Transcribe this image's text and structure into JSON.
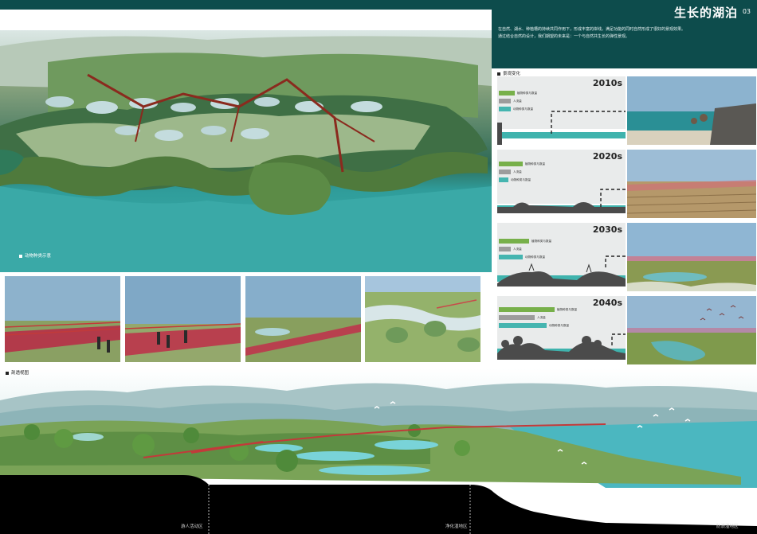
{
  "header": {
    "title": "生长的湖泊",
    "title_no": "03",
    "intro_line1": "在自然、湖水、种植槽的持续共同作用下，形成丰富的岸线。满足功能的同时自然形成了很好的景观效果。",
    "intro_line2": "通过结合自然的设计，我们期望的未来是：一个与自然共生长的弹性景观。"
  },
  "aerial": {
    "species_label": "动物种类示意",
    "species": [
      {
        "icon": "otter-icon",
        "color": "#8c4a22"
      },
      {
        "icon": "heron-icon",
        "color": "#1f3f7a"
      },
      {
        "icon": "egret-icon",
        "color": "#2c5f95"
      },
      {
        "icon": "crane-icon",
        "color": "#b86a2a"
      },
      {
        "icon": "duck-icon",
        "color": "#7b8a3a"
      },
      {
        "icon": "frog-icon",
        "color": "#6e8c2e"
      },
      {
        "icon": "butterfly-icon",
        "color": "#587a2b"
      },
      {
        "icon": "turtle-icon",
        "color": "#4f6b2a"
      },
      {
        "icon": "bird-icon",
        "color": "#8a6d3a"
      },
      {
        "icon": "fish-icon",
        "color": "#3e7a4c"
      },
      {
        "icon": "snail-icon",
        "color": "#6a4b3a"
      },
      {
        "icon": "crab-icon",
        "color": "#9a6044"
      },
      {
        "icon": "shell-icon",
        "color": "#c98a6a"
      },
      {
        "icon": "coral-icon",
        "color": "#b84e4e"
      }
    ]
  },
  "change": {
    "label": "景观变化",
    "legend_labels": {
      "plant": "植物种类与数量",
      "human": "人流量",
      "animal": "动物种类与数量"
    },
    "colors": {
      "plant": "#77b04a",
      "human": "#9c9c9c",
      "animal": "#45b5b0"
    },
    "rows": [
      {
        "year": "2010s",
        "plant": 0.2,
        "human": 0.15,
        "animal": 0.15
      },
      {
        "year": "2020s",
        "plant": 0.3,
        "human": 0.15,
        "animal": 0.12
      },
      {
        "year": "2030s",
        "plant": 0.38,
        "human": 0.15,
        "animal": 0.3
      },
      {
        "year": "2040s",
        "plant": 0.7,
        "human": 0.45,
        "animal": 0.6
      }
    ]
  },
  "section": {
    "label": "剖透视图",
    "zones": [
      "游人活动区",
      "净化湿地区",
      "防浪湿地区"
    ]
  }
}
